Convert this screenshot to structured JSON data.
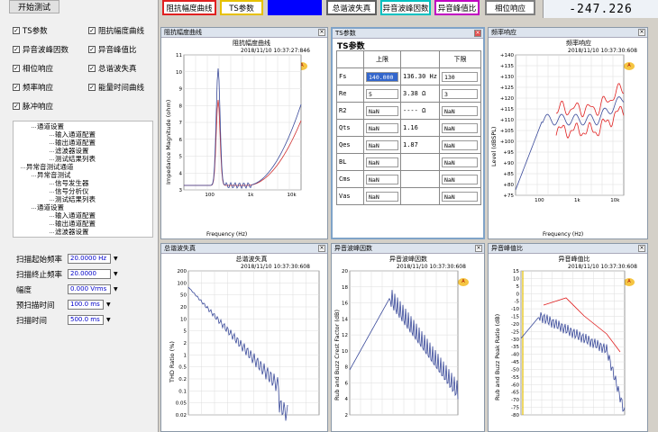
{
  "left": {
    "start_button": "开始测试",
    "checks": [
      {
        "label": "TS参数",
        "checked": true
      },
      {
        "label": "阻抗幅度曲线",
        "checked": true
      },
      {
        "label": "异音波峰因数",
        "checked": true
      },
      {
        "label": "异音峰值比",
        "checked": true
      },
      {
        "label": "相位响应",
        "checked": true
      },
      {
        "label": "总谐波失真",
        "checked": true
      },
      {
        "label": "频率响应",
        "checked": true
      },
      {
        "label": "能量时间曲线",
        "checked": true
      },
      {
        "label": "脉冲响应",
        "checked": true
      }
    ],
    "tree": [
      "通道设置",
      "输入通道配置",
      "输出通道配置",
      "滤波器设置",
      "测试结果列表",
      "异常音测试通道",
      "异常音测试",
      "信号发生器",
      "信号分析仪",
      "测试结果列表",
      "通道设置",
      "输入通道配置",
      "输出通道配置",
      "滤波器设置"
    ],
    "settings": [
      {
        "label": "扫描起始频率",
        "value": "20.0000 Hz"
      },
      {
        "label": "扫描终止频率",
        "value": "20.0000 kHz"
      },
      {
        "label": "幅度",
        "value": "0.000 Vrms"
      },
      {
        "label": "预扫描时间",
        "value": "100.0 ms"
      },
      {
        "label": "扫描时间",
        "value": "500.0 ms"
      }
    ]
  },
  "toolbar": {
    "buttons": [
      "阻抗幅度曲线",
      "TS参数",
      "",
      "总谐波失真",
      "异音波峰因数",
      "异音峰值比",
      "相位响应"
    ],
    "colors": [
      "#e02020",
      "#e6c000",
      "#0000ff",
      "#606060",
      "#00c0c0",
      "#c000c0",
      "#808080"
    ],
    "readout": "-247.226"
  },
  "panels": {
    "impedance": {
      "tab": "阻抗幅度曲线",
      "title": "阻抗幅度曲线",
      "timestamp": "2018/11/10 10:37:27:846",
      "ylabel": "Impedance Magnitude (ohm)",
      "xlabel": "Frequency (Hz)",
      "yticks": [
        "11",
        "10",
        "9",
        "8",
        "7",
        "6",
        "5",
        "4",
        "3"
      ],
      "xticks": [
        "100",
        "1k",
        "10k"
      ]
    },
    "ts": {
      "tab": "TS参数",
      "title": "TS参数",
      "col_upper": "上限",
      "col_lower": "下限",
      "rows": [
        {
          "name": "Fs",
          "upper": "140.000",
          "value": "136.30",
          "unit": "Hz",
          "lower": "130"
        },
        {
          "name": "Re",
          "upper": "5",
          "value": "3.38",
          "unit": "Ω",
          "lower": "3"
        },
        {
          "name": "R2",
          "upper": "NaN",
          "value": "----",
          "unit": "Ω",
          "lower": "NaN"
        },
        {
          "name": "Qts",
          "upper": "NaN",
          "value": "1.16",
          "unit": "",
          "lower": "NaN"
        },
        {
          "name": "Qes",
          "upper": "NaN",
          "value": "1.87",
          "unit": "",
          "lower": "NaN"
        },
        {
          "name": "BL",
          "upper": "NaN",
          "value": "",
          "unit": "",
          "lower": "NaN"
        },
        {
          "name": "Cms",
          "upper": "NaN",
          "value": "",
          "unit": "",
          "lower": "NaN"
        },
        {
          "name": "Vas",
          "upper": "NaN",
          "value": "",
          "unit": "",
          "lower": "NaN"
        }
      ]
    },
    "freq": {
      "tab": "频率响应",
      "title": "频率响应",
      "timestamp": "2018/11/10 10:37:30:608",
      "ylabel": "Level (dBSPL)",
      "xlabel": "Frequency (Hz)",
      "yticks": [
        "+140",
        "+135",
        "+130",
        "+125",
        "+120",
        "+115",
        "+110",
        "+105",
        "+100",
        "+95",
        "+90",
        "+85",
        "+80",
        "+75"
      ],
      "xticks": [
        "100",
        "1k",
        "10k"
      ]
    },
    "thd": {
      "tab": "总谐波失真",
      "title": "总谐波失真",
      "timestamp": "2018/11/10 10:37:30:608",
      "ylabel": "THD Ratio (%)",
      "yticks": [
        "200",
        "100",
        "50",
        "20",
        "10",
        "5",
        "2",
        "1",
        "0.5",
        "0.2",
        "0.1",
        "0.05",
        "0.02"
      ]
    },
    "crest": {
      "tab": "异音波峰因数",
      "title": "异音波峰因数",
      "timestamp": "2018/11/10 10:37:30:608",
      "ylabel": "Rub and Buzz Crest Factor (dB)",
      "yticks": [
        "20",
        "18",
        "16",
        "14",
        "12",
        "10",
        "8",
        "6",
        "4",
        "2"
      ]
    },
    "peak": {
      "tab": "异音峰值比",
      "title": "异音峰值比",
      "timestamp": "2018/11/10 10:37:30:608",
      "ylabel": "Rub and Buzz Peak Ratio (dB)",
      "yticks": [
        "15",
        "10",
        "5",
        "0",
        "-5",
        "-10",
        "-15",
        "-20",
        "-25",
        "-30",
        "-35",
        "-40",
        "-45",
        "-50",
        "-55",
        "-60",
        "-65",
        "-70",
        "-75",
        "-80"
      ]
    }
  }
}
